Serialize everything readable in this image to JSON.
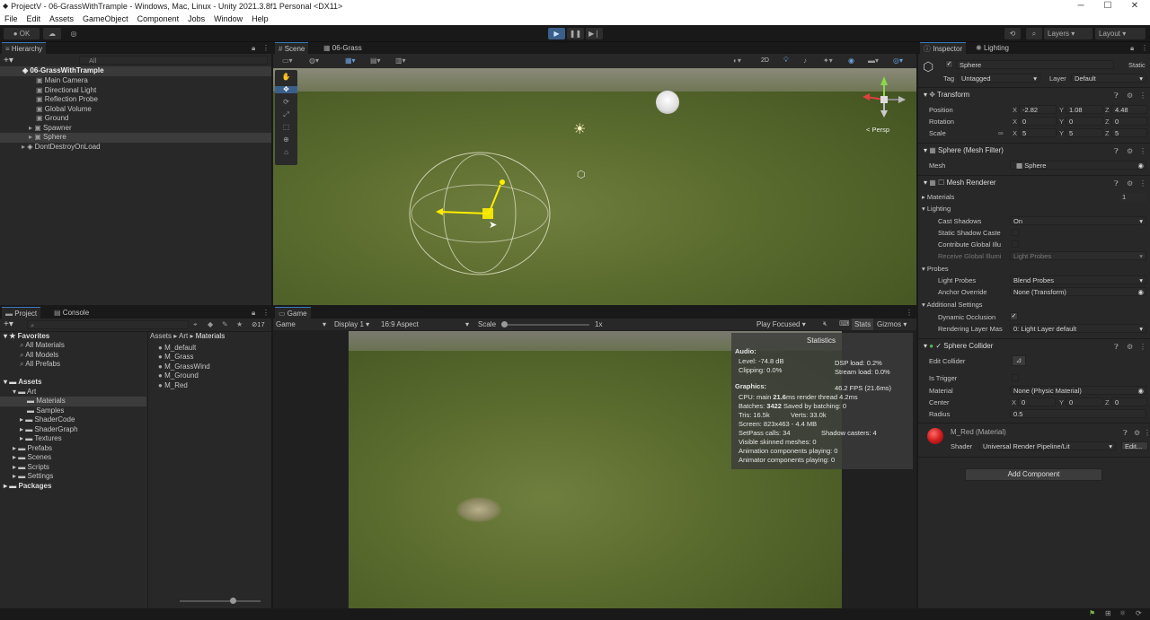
{
  "window": {
    "title": "ProjectV - 06-GrassWithTrample - Windows, Mac, Linux - Unity 2021.3.8f1 Personal <DX11>"
  },
  "menu": [
    "File",
    "Edit",
    "Assets",
    "GameObject",
    "Component",
    "Jobs",
    "Window",
    "Help"
  ],
  "toolbar": {
    "account": "OK",
    "layers": "Layers",
    "layout": "Layout"
  },
  "hierarchy": {
    "tab": "Hierarchy",
    "search_placeholder": "All",
    "scene": "06-GrassWithTrample",
    "items": [
      "Main Camera",
      "Directional Light",
      "Reflection Probe",
      "Global Volume",
      "Ground",
      "Spawner",
      "Sphere"
    ],
    "dont_destroy": "DontDestroyOnLoad"
  },
  "scene_view": {
    "tabs": [
      "Scene",
      "06-Grass"
    ],
    "mode_2d": "2D",
    "persp": "< Persp"
  },
  "project": {
    "tabs": [
      "Project",
      "Console"
    ],
    "count": "17",
    "favorites": "Favorites",
    "fav_items": [
      "All Materials",
      "All Models",
      "All Prefabs"
    ],
    "assets": "Assets",
    "tree": [
      "Art",
      "Materials",
      "Samples",
      "ShaderCode",
      "ShaderGraph",
      "Textures",
      "Prefabs",
      "Scenes",
      "Scripts",
      "Settings"
    ],
    "packages": "Packages",
    "breadcrumb": [
      "Assets",
      "Art",
      "Materials"
    ],
    "files": [
      "M_default",
      "M_Grass",
      "M_GrassWind",
      "M_Ground",
      "M_Red"
    ]
  },
  "game_view": {
    "tab": "Game",
    "mode": "Game",
    "display": "Display 1",
    "aspect": "16:9 Aspect",
    "scale_label": "Scale",
    "scale_value": "1x",
    "play_focused": "Play Focused",
    "stats_btn": "Stats",
    "gizmos": "Gizmos"
  },
  "stats": {
    "title": "Statistics",
    "audio": "Audio:",
    "level": "Level: -74.8 dB",
    "clipping": "Clipping: 0.0%",
    "dsp": "DSP load: 0.2%",
    "stream": "Stream load: 0.0%",
    "graphics": "Graphics:",
    "fps": "46.2 FPS (21.6ms)",
    "cpu_a": "CPU: main ",
    "cpu_b": "21.6",
    "cpu_c": "ms  render thread 4.2ms",
    "batches_a": "Batches: ",
    "batches_b": "3422",
    "batches_c": "  Saved by batching: 0",
    "tris": "Tris: 16.5k",
    "verts": "Verts: 33.0k",
    "screen": "Screen: 823x463 - 4.4 MB",
    "setpass": "SetPass calls: 34",
    "shadow": "Shadow casters: 4",
    "skinned": "Visible skinned meshes: 0",
    "animation": "Animation components playing: 0",
    "animator": "Animator components playing: 0"
  },
  "inspector": {
    "tabs": [
      "Inspector",
      "Lighting"
    ],
    "object_name": "Sphere",
    "static": "Static",
    "tag_label": "Tag",
    "tag": "Untagged",
    "layer_label": "Layer",
    "layer": "Default",
    "transform": {
      "title": "Transform",
      "position": "Position",
      "rotation": "Rotation",
      "scale": "Scale",
      "px": "-2.82",
      "py": "1.08",
      "pz": "4.48",
      "rx": "0",
      "ry": "0",
      "rz": "0",
      "sx": "5",
      "sy": "5",
      "sz": "5"
    },
    "mesh_filter": {
      "title": "Sphere (Mesh Filter)",
      "mesh_label": "Mesh",
      "mesh": "Sphere"
    },
    "mesh_renderer": {
      "title": "Mesh Renderer",
      "materials": "Materials",
      "mat_count": "1",
      "lighting": "Lighting",
      "cast_shadows": "Cast Shadows",
      "cast_value": "On",
      "static_shadow": "Static Shadow Caste",
      "contribute": "Contribute Global Illu",
      "receive": "Receive Global Illumi",
      "receive_value": "Light Probes",
      "probes": "Probes",
      "light_probes": "Light Probes",
      "light_probes_value": "Blend Probes",
      "anchor": "Anchor Override",
      "anchor_value": "None (Transform)",
      "additional": "Additional Settings",
      "dynamic_occ": "Dynamic Occlusion",
      "rendering_layer": "Rendering Layer Mas",
      "rendering_layer_value": "0: Light Layer default"
    },
    "collider": {
      "title": "Sphere Collider",
      "edit": "Edit Collider",
      "trigger": "Is Trigger",
      "material": "Material",
      "material_value": "None (Physic Material)",
      "center": "Center",
      "cx": "0",
      "cy": "0",
      "cz": "0",
      "radius": "Radius",
      "radius_value": "0.5"
    },
    "material": {
      "name": "M_Red (Material)",
      "shader_label": "Shader",
      "shader": "Universal Render Pipeline/Lit",
      "edit": "Edit..."
    },
    "add_component": "Add Component"
  }
}
